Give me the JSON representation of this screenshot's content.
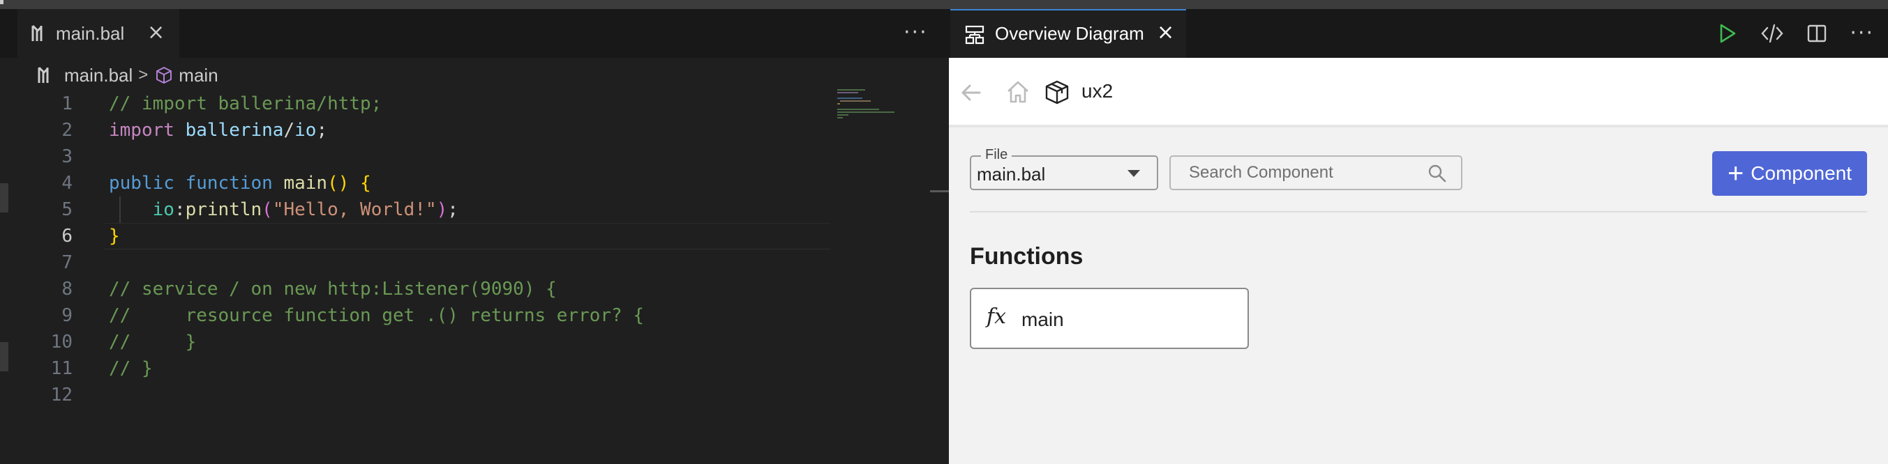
{
  "editor": {
    "tab": {
      "label": "main.bal",
      "close": "×"
    },
    "more": "···",
    "breadcrumb": {
      "file": "main.bal",
      "separator": ">",
      "symbol": "main"
    },
    "lines": [
      {
        "n": "1",
        "tokens": [
          [
            "c-cmt",
            "// import ballerina/http;"
          ]
        ]
      },
      {
        "n": "2",
        "tokens": [
          [
            "c-kw",
            "import"
          ],
          [
            "c-punc",
            " "
          ],
          [
            "c-id",
            "ballerina"
          ],
          [
            "c-punc",
            "/"
          ],
          [
            "c-id",
            "io"
          ],
          [
            "c-punc",
            ";"
          ]
        ]
      },
      {
        "n": "3",
        "tokens": []
      },
      {
        "n": "4",
        "tokens": [
          [
            "c-kw2",
            "public"
          ],
          [
            "c-punc",
            " "
          ],
          [
            "c-kw2",
            "function"
          ],
          [
            "c-punc",
            " "
          ],
          [
            "c-fn",
            "main"
          ],
          [
            "c-br1",
            "()"
          ],
          [
            "c-punc",
            " "
          ],
          [
            "c-br1",
            "{"
          ]
        ]
      },
      {
        "n": "5",
        "tokens": [
          [
            "c-punc",
            "    "
          ],
          [
            "c-id2",
            "io"
          ],
          [
            "c-punc",
            ":"
          ],
          [
            "c-fn",
            "println"
          ],
          [
            "c-br2",
            "("
          ],
          [
            "c-str",
            "\"Hello, World!\""
          ],
          [
            "c-br2",
            ")"
          ],
          [
            "c-punc",
            ";"
          ]
        ]
      },
      {
        "n": "6",
        "tokens": [
          [
            "c-br1",
            "}"
          ]
        ]
      },
      {
        "n": "7",
        "tokens": []
      },
      {
        "n": "8",
        "tokens": [
          [
            "c-cmt",
            "// service / on new http:Listener(9090) {"
          ]
        ]
      },
      {
        "n": "9",
        "tokens": [
          [
            "c-cmt",
            "//     resource function get .() returns error? {"
          ]
        ]
      },
      {
        "n": "10",
        "tokens": [
          [
            "c-cmt",
            "//     }"
          ]
        ]
      },
      {
        "n": "11",
        "tokens": [
          [
            "c-cmt",
            "// }"
          ]
        ]
      },
      {
        "n": "12",
        "tokens": []
      }
    ],
    "active_line": "6"
  },
  "panel": {
    "tab": {
      "label": "Overview Diagram",
      "close": "×"
    },
    "more": "···",
    "project_name": "ux2",
    "file_select": {
      "legend": "File",
      "value": "main.bal"
    },
    "search": {
      "placeholder": "Search Component"
    },
    "add_button": {
      "plus": "+",
      "label": "Component"
    },
    "section_title": "Functions",
    "functions": [
      {
        "icon_text": "fx",
        "name": "main"
      }
    ]
  },
  "colors": {
    "editor_bg": "#1f1f1f",
    "tabbar_bg": "#181818",
    "accent_button": "#4f66d6",
    "run_icon": "#3fb950",
    "active_tab_border": "#3a86d4"
  },
  "icons": [
    "ballerina-file-icon",
    "cube-icon",
    "diagram-icon",
    "run-icon",
    "code-icon",
    "split-editor-icon",
    "back-arrow-icon",
    "home-icon",
    "package-icon",
    "search-icon"
  ]
}
